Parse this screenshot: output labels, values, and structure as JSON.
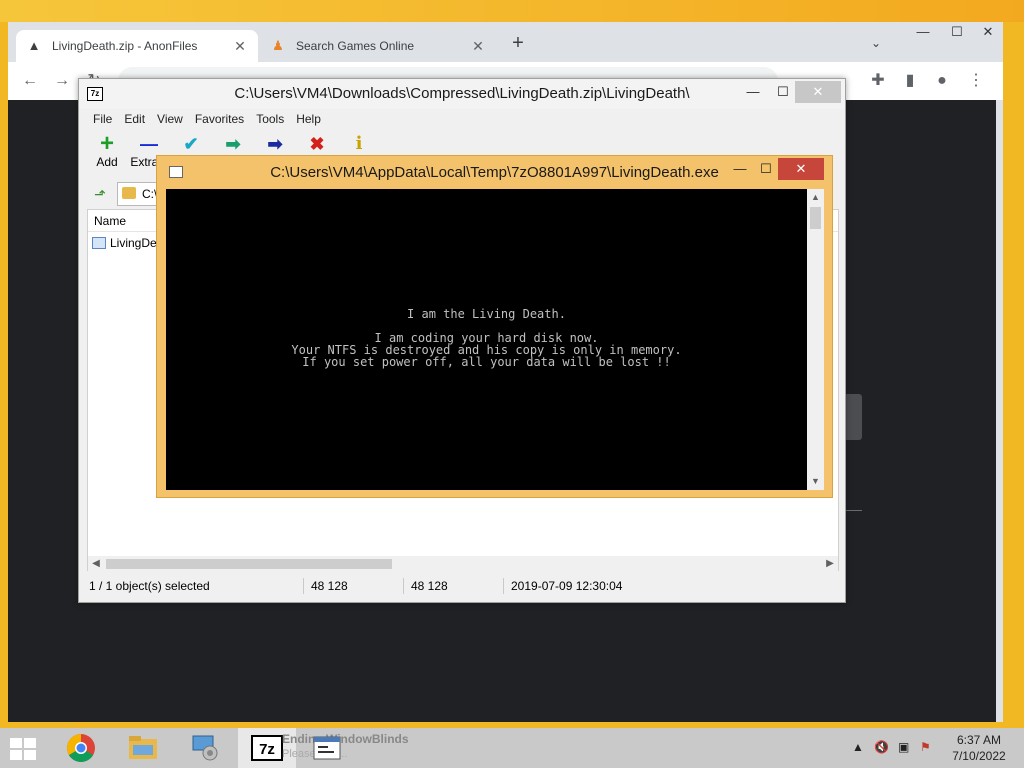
{
  "browser": {
    "tabs": [
      {
        "title": "LivingDeath.zip - AnonFiles",
        "icon": "anonfiles-icon"
      },
      {
        "title": "Search Games Online",
        "icon": "games-icon"
      }
    ],
    "new_tab": "+",
    "address": ""
  },
  "sevenzip": {
    "title": "C:\\Users\\VM4\\Downloads\\Compressed\\LivingDeath.zip\\LivingDeath\\",
    "menu": [
      "File",
      "Edit",
      "View",
      "Favorites",
      "Tools",
      "Help"
    ],
    "tools": [
      {
        "label": "Add",
        "glyph": "+",
        "color": "#1e9e28"
      },
      {
        "label": "Extract",
        "glyph": "—",
        "color": "#1a2bd6"
      },
      {
        "label": "",
        "glyph": "✔",
        "color": "#1aa8c8"
      },
      {
        "label": "",
        "glyph": "➡",
        "color": "#1a9e6e"
      },
      {
        "label": "",
        "glyph": "➡",
        "color": "#1a2b9e"
      },
      {
        "label": "",
        "glyph": "✖",
        "color": "#d4201a"
      },
      {
        "label": "",
        "glyph": "i",
        "color": "#c9a300"
      }
    ],
    "address": "C:\\",
    "column_name": "Name",
    "file_name": "LivingDeath.exe",
    "status": {
      "selected": "1 / 1 object(s) selected",
      "size": "48 128",
      "packed": "48 128",
      "date": "2019-07-09 12:30:04"
    }
  },
  "console": {
    "title": "C:\\Users\\VM4\\AppData\\Local\\Temp\\7zO8801A997\\LivingDeath.exe",
    "lines": [
      "I am the Living Death.",
      "I am coding your hard disk now.",
      "Your NTFS is destroyed and his copy is only in memory.",
      "If you set power off, all your data will be lost !!"
    ]
  },
  "taskbar": {
    "ghost_title": "Ending WindowBlinds",
    "ghost_sub": "Please wait...",
    "clock_time": "6:37 AM",
    "clock_date": "7/10/2022"
  }
}
